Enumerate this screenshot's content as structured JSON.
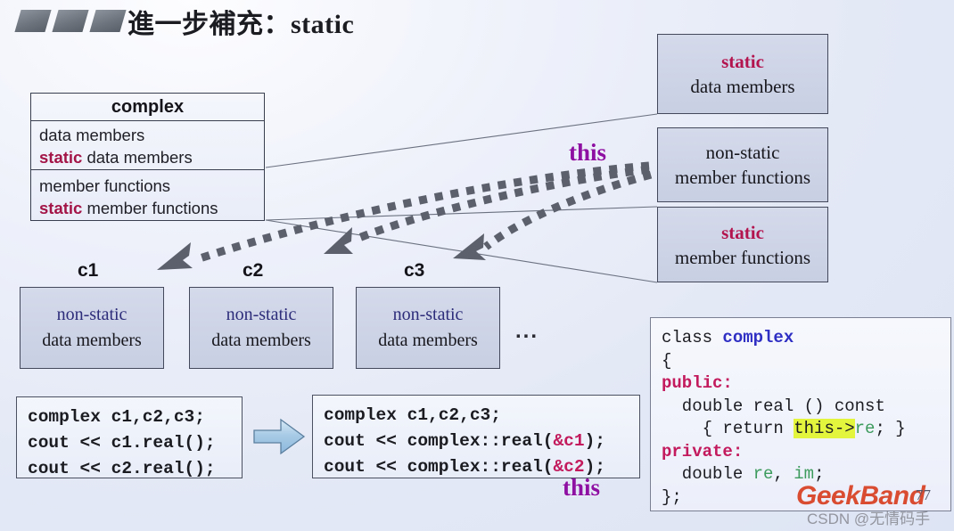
{
  "slide": {
    "title": "進一步補充：static",
    "bullet_shapes": 3,
    "background_color": "#e4e9f6"
  },
  "uml_class_box": {
    "name": "complex",
    "data_section": [
      {
        "text": "data members",
        "keyword": ""
      },
      {
        "text": "data members",
        "keyword": "static"
      }
    ],
    "function_section": [
      {
        "text": "member functions",
        "keyword": ""
      },
      {
        "text": "member functions",
        "keyword": "static"
      }
    ]
  },
  "right_boxes": [
    {
      "name": "static-data-members",
      "line1": "static",
      "line1_style": "red-bold",
      "line2": "data members"
    },
    {
      "name": "non-static-member-functions",
      "line1": "non-static",
      "line1_style": "plain",
      "line2": "member functions"
    },
    {
      "name": "static-member-functions",
      "line1": "static",
      "line1_style": "red-bold",
      "line2": "member functions"
    }
  ],
  "instances": [
    {
      "label": "c1",
      "line1": "non-static",
      "line2": "data members"
    },
    {
      "label": "c2",
      "line1": "non-static",
      "line2": "data members"
    },
    {
      "label": "c3",
      "line1": "non-static",
      "line2": "data members"
    }
  ],
  "instances_ellipsis": "...",
  "this_labels": {
    "top": "this",
    "bottom": "this"
  },
  "code_left": {
    "line1": "complex c1,c2,c3;",
    "line2": "cout << c1.real();",
    "line3": "cout << c2.real();"
  },
  "code_right": {
    "line1": "complex c1,c2,c3;",
    "line2_pre": "cout << complex::real(",
    "line2_amp": "&c1",
    "line2_post": ");",
    "line3_pre": "cout << complex::real(",
    "line3_amp": "&c2",
    "line3_post": ");"
  },
  "class_code": {
    "l1_kw": "class ",
    "l1_name": "complex",
    "l2": "{",
    "l3": "public:",
    "l4": "  double real () const",
    "l5_pre": "    { return ",
    "l5_hl": "this->",
    "l5_var": "re",
    "l5_post": "; }",
    "l6": "private:",
    "l7_pre": "  double ",
    "l7_v1": "re",
    "l7_mid": ", ",
    "l7_v2": "im",
    "l7_post": ";",
    "l8": "};"
  },
  "watermarks": {
    "brand": "GeekBand",
    "page_number": "77",
    "csdn": "CSDN @无情码手"
  },
  "colors": {
    "static_red": "#b3144e",
    "nonstatic_blue": "#2c2c7a",
    "this_purple": "#8d10a3",
    "highlight_yellow": "#e4f53d",
    "brand_red": "#d93b1d",
    "box_fill": "#c8cfe3",
    "arrow_blue": "#a8cbe6",
    "dotted_arrow_gray": "#5b606c"
  }
}
